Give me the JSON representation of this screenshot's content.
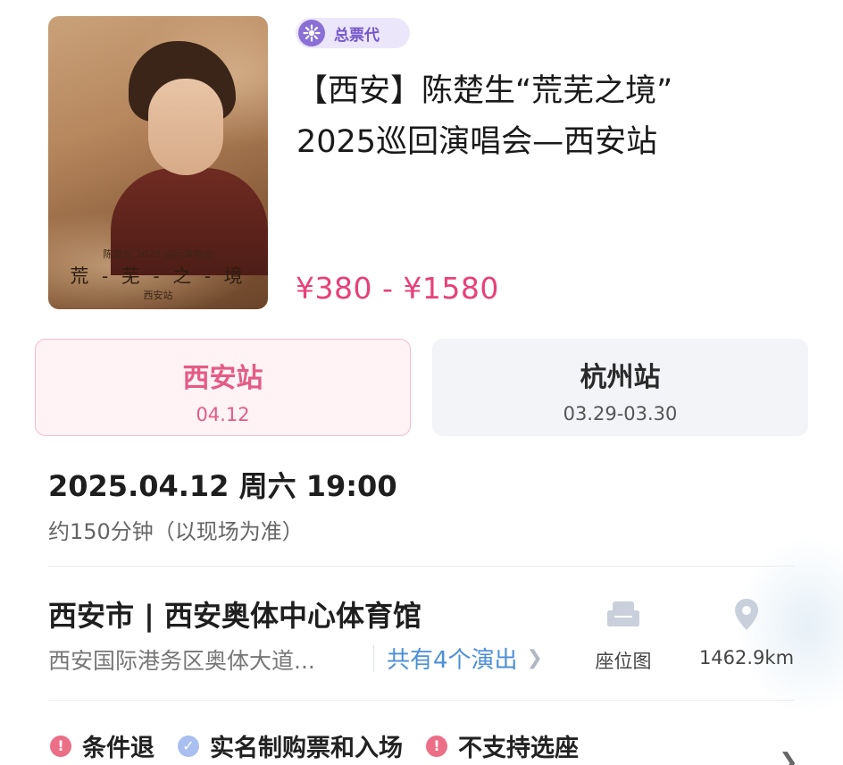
{
  "event": {
    "badge": "总票代",
    "title_line1": "【西安】陈楚生“荒芜之境”",
    "title_line2": "2025巡回演唱会—西安站",
    "price_range": "¥380 - ¥1580",
    "poster": {
      "line1": "陈楚生 2025 巡回演唱会",
      "line2": "荒 - 芜 - 之 - 境",
      "line3": "西安站"
    }
  },
  "cities": [
    {
      "name": "西安站",
      "date": "04.12",
      "selected": true
    },
    {
      "name": "杭州站",
      "date": "03.29-03.30",
      "selected": false
    }
  ],
  "schedule": {
    "datetime": "2025.04.12 周六 19:00",
    "duration": "约150分钟（以现场为准）"
  },
  "venue": {
    "name": "西安市 | 西安奥体中心体育馆",
    "address": "西安国际港务区奥体大道...",
    "show_count": "共有4个演出",
    "seat_map_label": "座位图",
    "distance": "1462.9km"
  },
  "services": [
    {
      "label": "条件退",
      "icon": "alert-icon"
    },
    {
      "label": "实名制购票和入场",
      "icon": "check-icon"
    },
    {
      "label": "不支持选座",
      "icon": "alert-icon"
    }
  ],
  "colors": {
    "price": "#e8407a",
    "selected_tab": "#e45c86",
    "link": "#4d8fd8",
    "badge": "#7457c9"
  }
}
